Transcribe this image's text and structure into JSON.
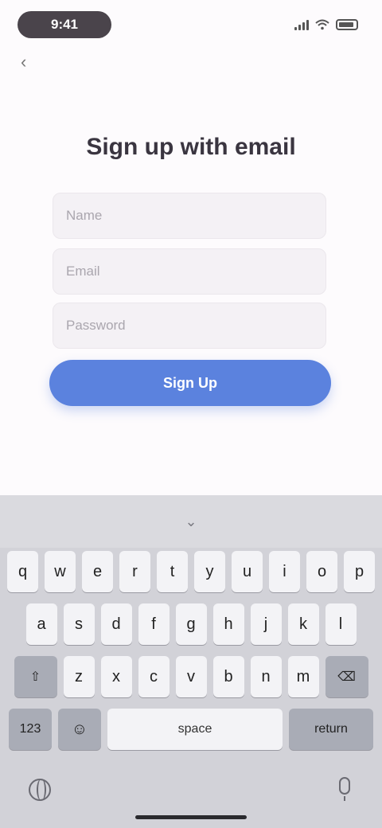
{
  "status_bar": {
    "time": "9:41"
  },
  "form": {
    "title": "Sign up with email",
    "name_placeholder": "Name",
    "email_placeholder": "Email",
    "password_placeholder": "Password",
    "submit_label": "Sign Up"
  },
  "keyboard": {
    "row1": [
      "q",
      "w",
      "e",
      "r",
      "t",
      "y",
      "u",
      "i",
      "o",
      "p"
    ],
    "row2": [
      "a",
      "s",
      "d",
      "f",
      "g",
      "h",
      "j",
      "k",
      "l"
    ],
    "row3": [
      "z",
      "x",
      "c",
      "v",
      "b",
      "n",
      "m"
    ],
    "shift_label": "⇧",
    "delete_label": "⌫",
    "numbers_label": "123",
    "emoji_label": "☺",
    "space_label": "space",
    "return_label": "return"
  },
  "colors": {
    "accent": "#5b82de",
    "background": "#fdfbfd",
    "keyboard_bg": "#d2d2d8"
  }
}
